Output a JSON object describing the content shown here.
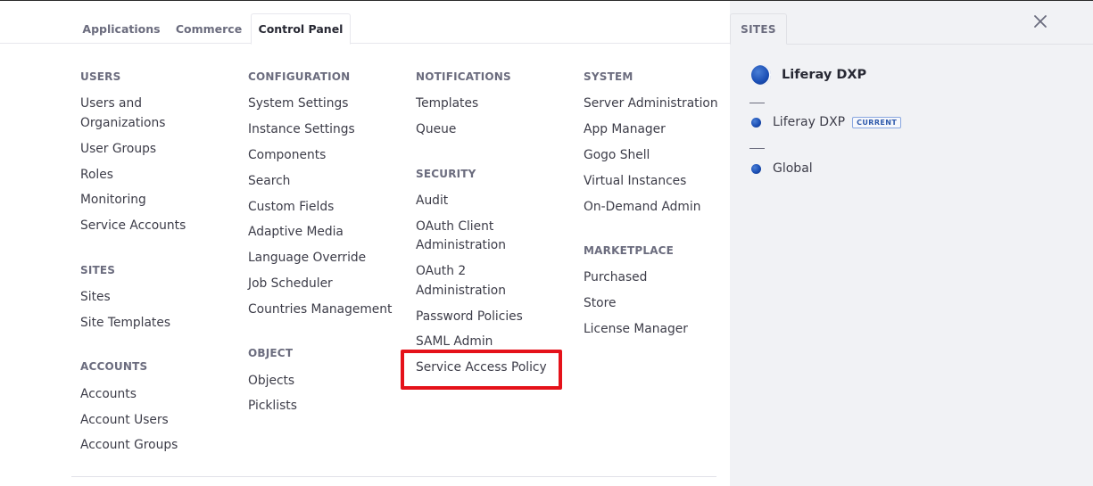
{
  "tabs": {
    "applications": "Applications",
    "commerce": "Commerce",
    "control_panel": "Control Panel"
  },
  "columns": {
    "users": {
      "heading": "USERS",
      "items": [
        "Users and",
        "Organizations",
        "User Groups",
        "Roles",
        "Monitoring",
        "Service Accounts"
      ]
    },
    "sites": {
      "heading": "SITES",
      "items": [
        "Sites",
        "Site Templates"
      ]
    },
    "accounts": {
      "heading": "ACCOUNTS",
      "items": [
        "Accounts",
        "Account Users",
        "Account Groups"
      ]
    },
    "configuration": {
      "heading": "CONFIGURATION",
      "items": [
        "System Settings",
        "Instance Settings",
        "Components",
        "Search",
        "Custom Fields",
        "Adaptive Media",
        "Language Override",
        "Job Scheduler",
        "Countries Management"
      ]
    },
    "object": {
      "heading": "OBJECT",
      "items": [
        "Objects",
        "Picklists"
      ]
    },
    "notifications": {
      "heading": "NOTIFICATIONS",
      "items": [
        "Templates",
        "Queue"
      ]
    },
    "security": {
      "heading": "SECURITY",
      "items": [
        "Audit",
        "OAuth Client",
        "Administration",
        "OAuth 2",
        "Administration",
        "Password Policies",
        "SAML Admin",
        "Service Access Policy"
      ]
    },
    "system": {
      "heading": "SYSTEM",
      "items": [
        "Server Administration",
        "App Manager",
        "Gogo Shell",
        "Virtual Instances",
        "On-Demand Admin"
      ]
    },
    "marketplace": {
      "heading": "MARKETPLACE",
      "items": [
        "Purchased",
        "Store",
        "License Manager"
      ]
    }
  },
  "sites_panel": {
    "tab": "SITES",
    "current_site": "Liferay DXP",
    "sites": [
      "Liferay DXP",
      "Global"
    ],
    "current_badge": "CURRENT"
  },
  "icons": {
    "close": "close-icon",
    "site_logo": "liferay-logo-icon"
  },
  "colors": {
    "highlight": "#e5121a",
    "accent": "#1b4fb5"
  }
}
